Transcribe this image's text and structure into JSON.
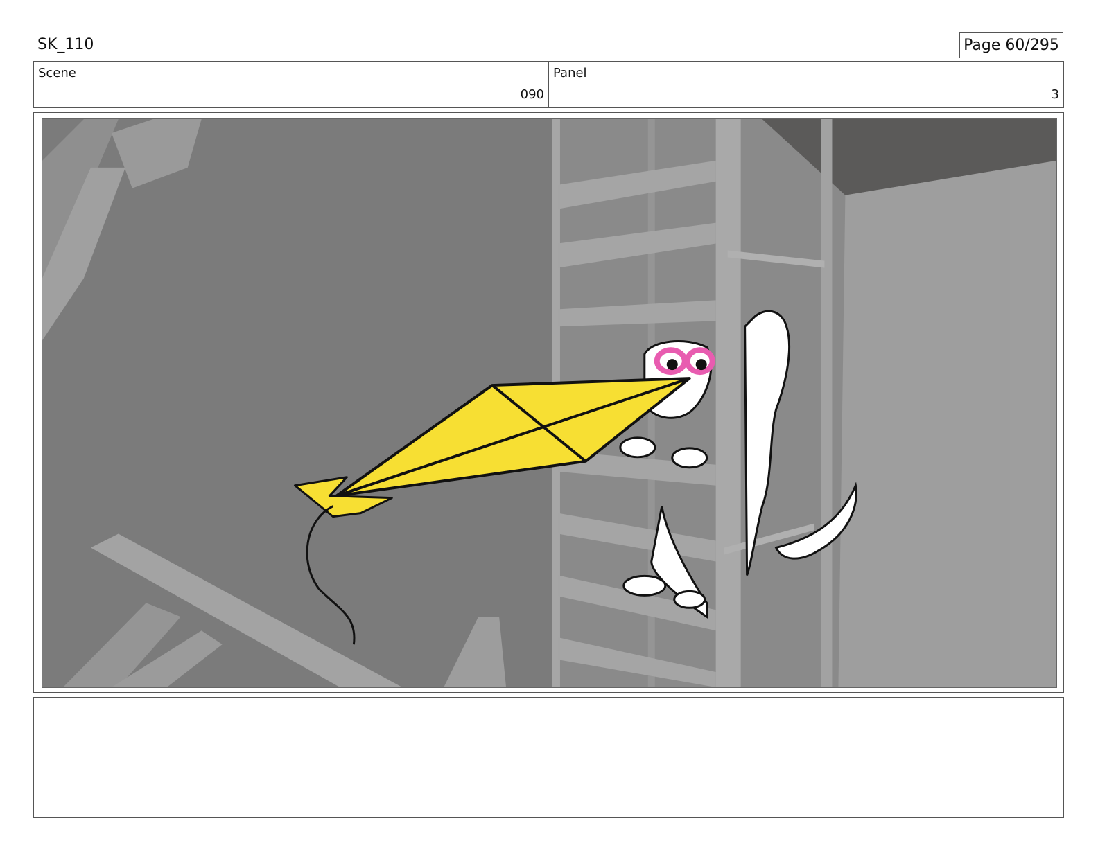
{
  "header": {
    "project_title": "SK_110",
    "page_label": "Page",
    "page_number": "60/295"
  },
  "info": {
    "scene_label": "Scene",
    "scene_value": "090",
    "panel_label": "Panel",
    "panel_value": "3"
  },
  "notes": {
    "text": ""
  },
  "colors": {
    "kite": "#f7df33",
    "cat_accent": "#e85cb0",
    "background": "#7b7b7b"
  }
}
